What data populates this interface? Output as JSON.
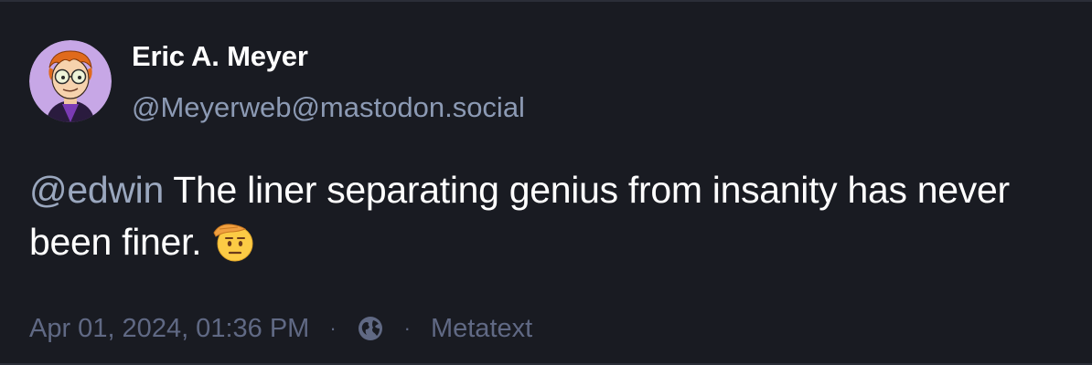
{
  "post": {
    "author": {
      "display_name": "Eric A. Meyer",
      "handle": "@Meyerweb@mastodon.social",
      "avatar_icon": "cartoon-avatar-icon"
    },
    "content": {
      "mention": "@edwin",
      "text": " The liner separating genius from insanity has never been finer.",
      "emoji": "saluting-face-emoji"
    },
    "footer": {
      "timestamp": "Apr 01, 2024, 01:36 PM",
      "separator": "·",
      "visibility_icon": "globe-icon",
      "application": "Metatext"
    }
  },
  "colors": {
    "background": "#191b22",
    "text_primary": "#ffffff",
    "text_secondary": "#8c9ab4",
    "text_muted": "#606984",
    "avatar_bg": "#c7a7e6"
  }
}
